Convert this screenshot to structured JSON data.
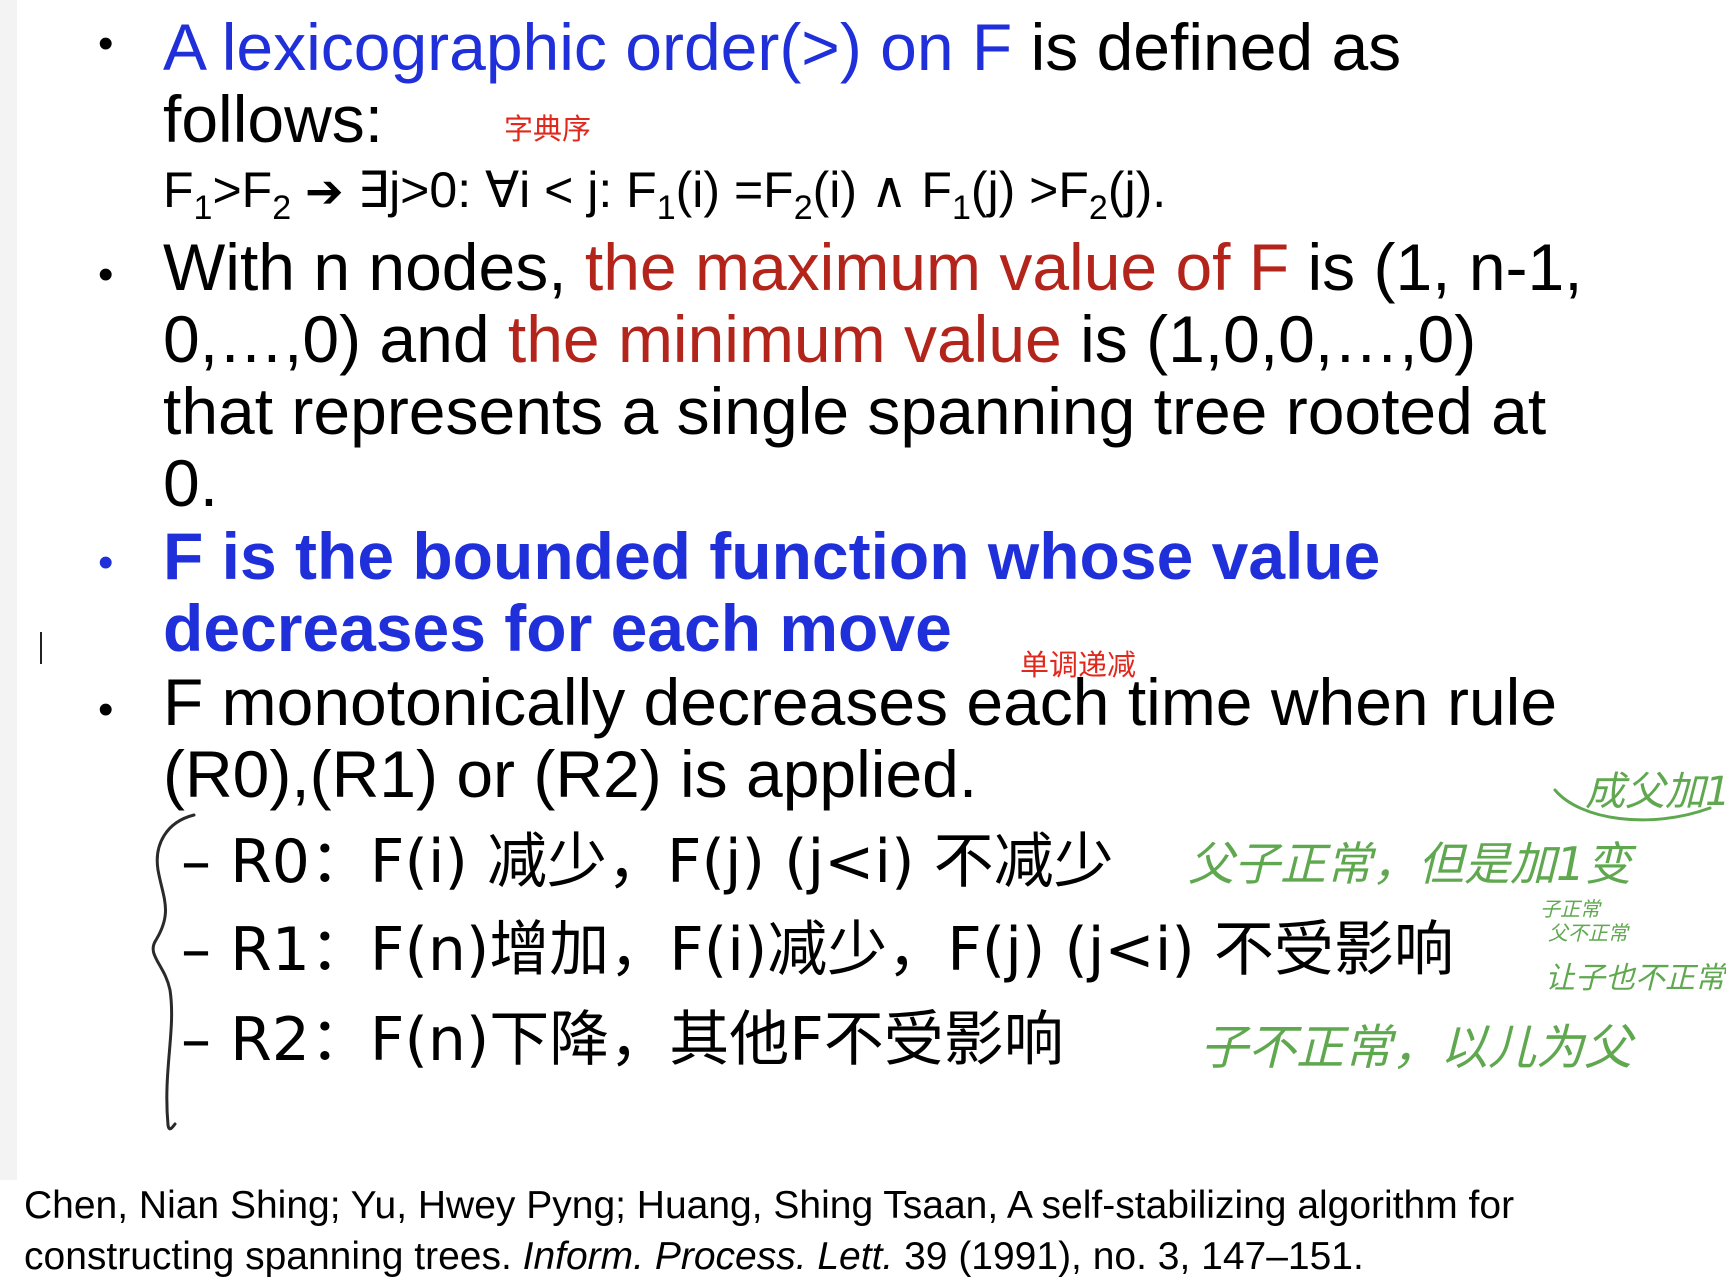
{
  "slide": {
    "bullets": {
      "b1": {
        "bullet": "•",
        "blue_part": "A lexicographic order(>) on F",
        "rest_part": " is defined as",
        "line2": "follows:",
        "formula": {
          "f1": "F",
          "s1": "1",
          "gt": ">",
          "f2": "F",
          "s2": "2",
          "arrow": "➔",
          "exists": " ∃j>0: ∀i < j: ",
          "f3": "F",
          "s3": "1",
          "p1": "(i) =",
          "f4": "F",
          "s4": "2",
          "p2": "(i) ∧ ",
          "f5": "F",
          "s5": "1",
          "p3": "(j) >",
          "f6": "F",
          "s6": "2",
          "p4": "(j)."
        }
      },
      "b2": {
        "bullet": "•",
        "l1_pre": "With n nodes, ",
        "l1_red": "the maximum value of F",
        "l1_post": " is (1, n-1,",
        "l2_pre": "0,…,0) and ",
        "l2_red": "the minimum value",
        "l2_post": " is (1,0,0,…,0)",
        "l3": "that represents a single spanning tree rooted at",
        "l4": "0."
      },
      "b3": {
        "bullet": "•",
        "l1": "F is the bounded function whose value",
        "l2": "decreases for each move"
      },
      "b4": {
        "bullet": "•",
        "l1": "F monotonically decreases each time when rule",
        "l2": "(R0),(R1) or (R2) is applied."
      }
    },
    "rules": [
      "– R0：F(i) 减少，F(j) (j<i) 不减少",
      "– R1：F(n)增加，F(i)减少，F(j) (j<i) 不受影响",
      "– R2：F(n)下降，其他F不受影响"
    ],
    "notes": {
      "lexicographic": "字典序",
      "monotonic": "单调递减"
    },
    "handwritten": {
      "top": "成父加1",
      "r0": "父子正常，但是加1变",
      "r1_a": "子正常",
      "r1_b": "父不正常",
      "r1_c": "让子也不正常",
      "r2": "子不正常，以儿为父"
    },
    "reference": {
      "pre": "Chen, Nian Shing; Yu, Hwey Pyng; Huang, Shing Tsaan, A self-stabilizing algorithm for",
      "l2_pre": "constructing spanning trees. ",
      "journal": "Inform. Process. Lett.",
      "l2_post": " 39 (1991), no. 3, 147–151."
    }
  }
}
